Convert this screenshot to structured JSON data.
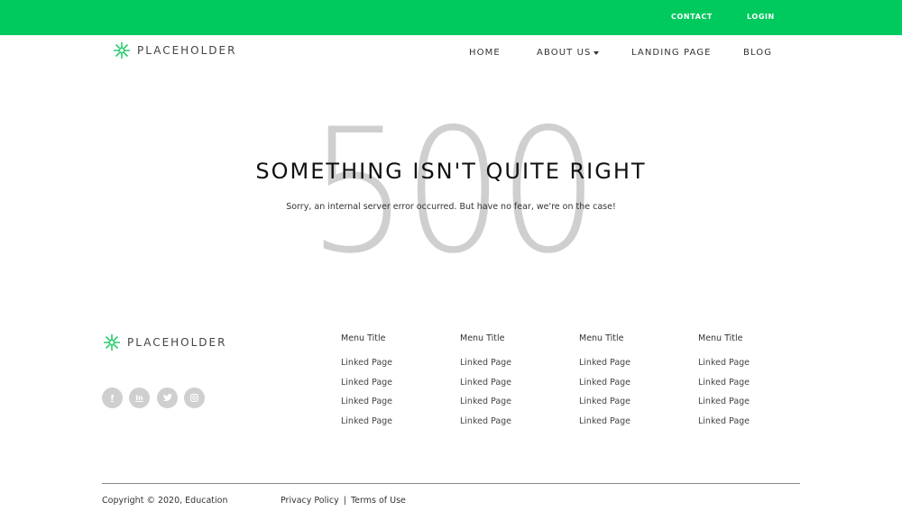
{
  "utility_bar": {
    "contact": "CONTACT",
    "login": "LOGIN",
    "color": "#00c95d"
  },
  "header": {
    "logo_text": "PLACEHOLDER",
    "nav": {
      "home": "HOME",
      "about": "ABOUT US",
      "landing": "LANDING PAGE",
      "blog": "BLOG"
    }
  },
  "hero": {
    "code": "500",
    "title": "SOMETHING ISN'T QUITE RIGHT",
    "message": "Sorry, an internal server error occurred. But have no fear, we're on the case!"
  },
  "footer": {
    "logo_text": "PLACEHOLDER",
    "social": [
      "facebook-icon",
      "linkedin-icon",
      "twitter-icon",
      "instagram-icon"
    ],
    "columns": [
      {
        "title": "Menu Title",
        "links": [
          "Linked Page",
          "Linked Page",
          "Linked Page",
          "Linked Page"
        ]
      },
      {
        "title": "Menu Title",
        "links": [
          "Linked Page",
          "Linked Page",
          "Linked Page",
          "Linked Page"
        ]
      },
      {
        "title": "Menu Title",
        "links": [
          "Linked Page",
          "Linked Page",
          "Linked Page",
          "Linked Page"
        ]
      },
      {
        "title": "Menu Title",
        "links": [
          "Linked Page",
          "Linked Page",
          "Linked Page",
          "Linked Page"
        ]
      }
    ],
    "copyright": "Copyright © 2020, Education",
    "privacy": "Privacy Policy",
    "separator": "|",
    "terms": "Terms of Use"
  }
}
